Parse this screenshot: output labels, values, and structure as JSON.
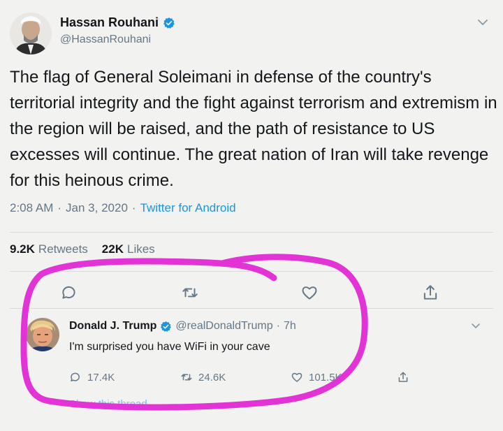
{
  "main_tweet": {
    "name": "Hassan Rouhani",
    "handle": "@HassanRouhani",
    "text": "The flag of General Soleimani in defense of the country's territorial integrity and the fight against terrorism and extremism in the region will be raised, and the path of resistance to US excesses will continue. The great nation of Iran will take revenge for this heinous crime.",
    "time": "2:08 AM",
    "sep1": "·",
    "date": "Jan 3, 2020",
    "sep2": "·",
    "source": "Twitter for Android",
    "retweets_count": "9.2K",
    "retweets_label": "Retweets",
    "likes_count": "22K",
    "likes_label": "Likes",
    "icons": [
      "reply-icon",
      "retweet-icon",
      "like-icon",
      "share-icon",
      "chevron-down-icon",
      "verified-icon"
    ]
  },
  "reply_tweet": {
    "name": "Donald J. Trump",
    "handle": "@realDonaldTrump",
    "sep": "·",
    "age": "7h",
    "text": "I'm surprised you have WiFi in your cave",
    "reply_count": "17.4K",
    "retweet_count": "24.6K",
    "like_count": "101.5K",
    "show_thread": "Show this thread"
  },
  "colors": {
    "accent": "#1b95e0",
    "annotation": "#e233d6",
    "muted": "#657786",
    "background": "#f2f2f0"
  }
}
